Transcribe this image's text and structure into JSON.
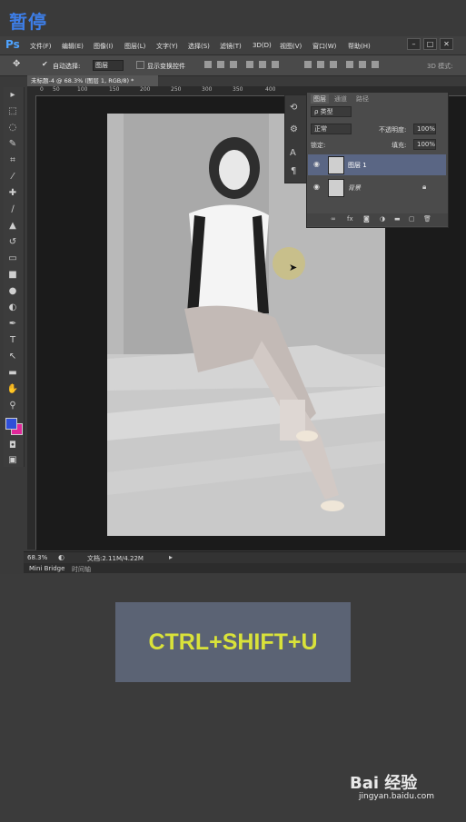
{
  "overlay": {
    "pause_label": "暂停"
  },
  "app": {
    "logo": "Ps"
  },
  "menu": [
    "文件(F)",
    "编辑(E)",
    "图像(I)",
    "图层(L)",
    "文字(Y)",
    "选择(S)",
    "滤镜(T)",
    "3D(D)",
    "视图(V)",
    "窗口(W)",
    "帮助(H)"
  ],
  "window_controls": [
    "–",
    "□",
    "✕"
  ],
  "options": {
    "auto_select_label": "自动选择:",
    "auto_select_value": "图层",
    "show_transform_label": "显示变换控件",
    "mode_3d": "3D 模式:"
  },
  "document": {
    "tab_title": "未标题-4 @ 68.3% (图层 1, RGB/8) *",
    "ruler_ticks": [
      "0",
      "50",
      "100",
      "150",
      "200",
      "250",
      "300",
      "350",
      "400"
    ],
    "zoom": "68.3%",
    "doc_size": "文档:2.11M/4.22M"
  },
  "bottom_tabs": [
    "Mini Bridge",
    "时间轴"
  ],
  "layers": {
    "tabs": [
      "图层",
      "通道",
      "路径"
    ],
    "filter_kind": "ρ 类型",
    "blend_mode": "正常",
    "opacity_label": "不透明度:",
    "opacity_value": "100%",
    "lock_label": "锁定:",
    "fill_label": "填充:",
    "fill_value": "100%",
    "items": [
      {
        "name": "图层 1",
        "selected": true
      },
      {
        "name": "背景",
        "selected": false
      }
    ],
    "footer_icons": [
      "link-icon",
      "fx-icon",
      "mask-icon",
      "adjustment-icon",
      "folder-icon",
      "new-layer-icon",
      "trash-icon"
    ]
  },
  "shortcut": {
    "text": "CTRL+SHIFT+U",
    "bg": "#5b6374",
    "color": "#d9e23a"
  },
  "watermark": {
    "brand": "Bai 经验",
    "url": "jingyan.baidu.com"
  },
  "colors": {
    "foreground": "#2f4fd8",
    "background": "#e0279a",
    "ps_blue": "#4ea3ff"
  }
}
